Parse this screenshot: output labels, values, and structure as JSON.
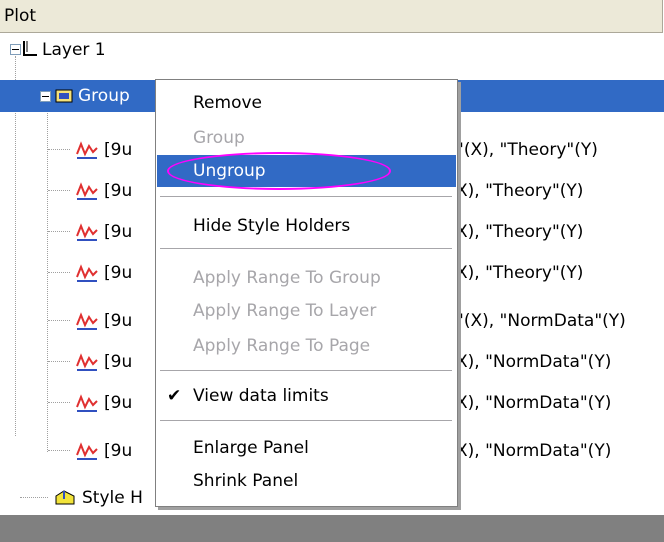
{
  "panel": {
    "title": "Plot"
  },
  "tree": {
    "layer_label": "Layer 1",
    "group_label": "Group",
    "rows": [
      {
        "left_text": "[9u",
        "right_text": "\"(X), \"Theory\"(Y)"
      },
      {
        "left_text": "[9u",
        "right_text": "X), \"Theory\"(Y)"
      },
      {
        "left_text": "[9u",
        "right_text": "X), \"Theory\"(Y)"
      },
      {
        "left_text": "[9u",
        "right_text": "X), \"Theory\"(Y)"
      },
      {
        "left_text": "[9u",
        "right_text": "\"(X), \"NormData\"(Y)"
      },
      {
        "left_text": "[9u",
        "right_text": "X), \"NormData\"(Y)"
      },
      {
        "left_text": "[9u",
        "right_text": "X), \"NormData\"(Y)"
      },
      {
        "left_text": "[9u",
        "right_text": "X), \"NormData\"(Y)"
      }
    ],
    "style_holders_label": "Style H"
  },
  "context_menu": {
    "items": [
      {
        "label": "Remove",
        "enabled": true
      },
      {
        "label": "Group",
        "enabled": false
      },
      {
        "label": "Ungroup",
        "enabled": true,
        "highlighted": true
      },
      {
        "label": "Hide Style Holders",
        "enabled": true
      },
      {
        "label": "Apply Range To Group",
        "enabled": false
      },
      {
        "label": "Apply Range To Layer",
        "enabled": false
      },
      {
        "label": "Apply Range To Page",
        "enabled": false
      },
      {
        "label": "View data limits",
        "enabled": true,
        "checked": true
      },
      {
        "label": "Enlarge Panel",
        "enabled": true
      },
      {
        "label": "Shrink Panel",
        "enabled": true
      }
    ],
    "check_glyph": "✔"
  },
  "colors": {
    "selection": "#316ac5",
    "annotation": "#ff00ff",
    "disabled": "#a7a6aa"
  },
  "icons": {
    "layer": "layer-axes-icon",
    "group": "group-folder-icon",
    "plot": "plot-curve-icon",
    "style": "style-holder-icon"
  }
}
